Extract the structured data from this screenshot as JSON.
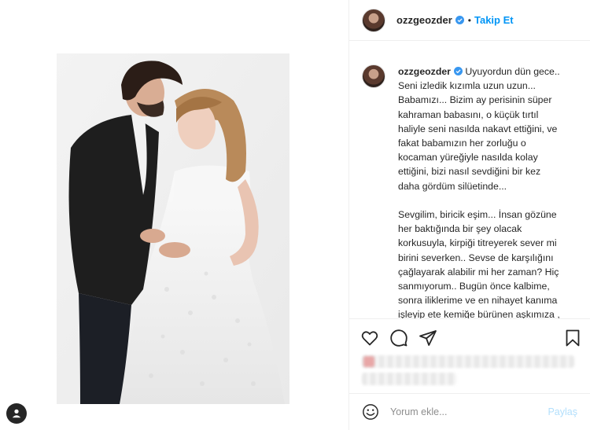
{
  "header": {
    "username": "ozzgeozder",
    "separator": "•",
    "follow_label": "Takip Et"
  },
  "caption": {
    "username": "ozzgeozder",
    "text": " Uyuyordun dün gece..\nSeni izledik kızımla uzun uzun...\nBabamızı... Bizim ay perisinin süper\nkahraman babasını, o küçük tırtıl\nhaliyle seni nasılda nakavt ettiğini, ve\nfakat babamızın her zorluğu o\nkocaman yüreğiyle nasılda kolay\nettiğini, bizi nasıl sevdiğini bir kez\ndaha gördüm silüetinde...\n\nSevgilim, biricik eşim... İnsan gözüne\nher baktığında bir şey olacak\nkorkusuyla, kirpiği titreyerek sever mi\nbirini severken.. Sevse de karşılığını\nçağlayarak alabilir mi her zaman? Hiç\nsanmıyorum.. Bugün önce kalbime,\nsonra iliklerime ve en nihayet kanıma\nişleyip ete kemiğe bürünen aşkımıza ,\nyani kızımıza her baktığımda Tanrı'nın"
  },
  "actions": {
    "like_icon": "heart-icon",
    "comment_icon": "comment-icon",
    "share_icon": "share-icon",
    "save_icon": "bookmark-icon"
  },
  "comment": {
    "placeholder": "Yorum ekle...",
    "post_label": "Paylaş"
  },
  "colors": {
    "accent": "#0095f6",
    "post_disabled": "#b2dffc",
    "verified": "#3897f0"
  }
}
